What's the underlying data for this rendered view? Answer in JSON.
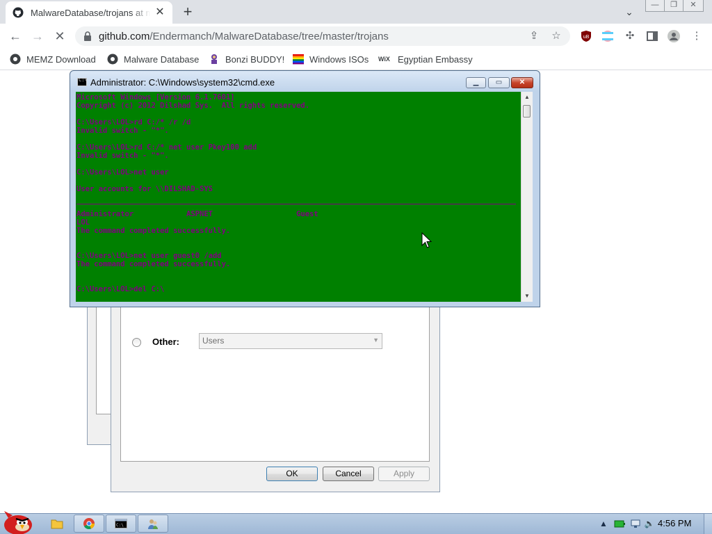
{
  "browser": {
    "tab_title": "MalwareDatabase/trojans at master",
    "tab_close": "✕",
    "new_tab": "+",
    "url_main": "github.com",
    "url_path": "/Endermanch/MalwareDatabase/tree/master/trojans",
    "bookmarks": [
      {
        "label": "MEMZ Download",
        "icon": "github-icon"
      },
      {
        "label": "Malware Database",
        "icon": "github-icon"
      },
      {
        "label": "Bonzi BUDDY!",
        "icon": "bonzi-icon"
      },
      {
        "label": "Windows ISOs",
        "icon": "rainbow-flag-icon"
      },
      {
        "label": "Egyptian Embassy",
        "icon": "wix-icon"
      }
    ],
    "wix_text": "WiX"
  },
  "cmd": {
    "title": "Administrator: C:\\Windows\\system32\\cmd.exe",
    "lines": [
      "Microsoft Windows [Version 6.1.7601]",
      "Copyright (c) 2012 Dilshad Sys.  All rights reserved.",
      "",
      "C:\\Users\\LOL>rd C:/* /r /d",
      "Invalid switch - \"*\".",
      "",
      "C:\\Users\\LOL>rd C:/* net user Pkey100 add",
      "Invalid switch - \"*\".",
      "",
      "C:\\Users\\LOL>net user",
      "",
      "User accounts for \\\\DILSHAD-SYS",
      "",
      "",
      "Administrator            ASPNET                   Guest",
      "LOL",
      "The command completed successfully.",
      "",
      "",
      "C:\\Users\\LOL>net user guest0 /add",
      "The command completed successfully.",
      "",
      "",
      "C:\\Users\\LOL>del C:\\"
    ],
    "colors": {
      "background": "#008000",
      "text": "#800080"
    }
  },
  "dialog": {
    "other_label": "Other:",
    "other_value": "Users",
    "ok_label": "OK",
    "cancel_label": "Cancel",
    "apply_label": "Apply"
  },
  "taskbar": {
    "clock": "4:56 PM"
  }
}
